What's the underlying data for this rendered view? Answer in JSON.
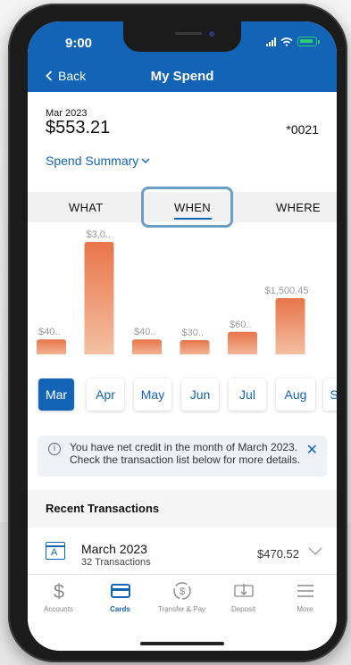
{
  "status": {
    "time": "9:00"
  },
  "header": {
    "back_label": "Back",
    "title": "My Spend"
  },
  "summary": {
    "period": "Mar 2023",
    "amount": "$553.21",
    "account": "*0021",
    "selector_label": "Spend Summary"
  },
  "tabs": [
    {
      "label": "WHAT",
      "selected": false
    },
    {
      "label": "WHEN",
      "selected": true
    },
    {
      "label": "WHERE",
      "selected": false
    }
  ],
  "chart_data": {
    "type": "bar",
    "categories": [
      "Mar",
      "Apr",
      "May",
      "Jun",
      "Jul",
      "Aug"
    ],
    "values": [
      400,
      3000,
      400,
      300,
      600,
      1500.45
    ],
    "data_labels": [
      "$40..",
      "$3,0..",
      "$40..",
      "$30..",
      "$60..",
      "$1,500.45"
    ],
    "bar_color_top": "#e8754a",
    "bar_color_bottom": "#f4c3a6"
  },
  "months": [
    {
      "label": "Mar",
      "active": true
    },
    {
      "label": "Apr",
      "active": false
    },
    {
      "label": "May",
      "active": false
    },
    {
      "label": "Jun",
      "active": false
    },
    {
      "label": "Jul",
      "active": false
    },
    {
      "label": "Aug",
      "active": false
    },
    {
      "label": "Sep",
      "active": false
    }
  ],
  "notice": {
    "text": "You have net credit in the month of March 2023. Check the transaction list below for more details."
  },
  "recent": {
    "title": "Recent Transactions",
    "item": {
      "icon_letter": "A",
      "title": "March 2023",
      "subtitle": "32 Transactions",
      "amount": "$470.52"
    }
  },
  "tabbar": [
    {
      "label": "Accounts",
      "icon": "dollar-icon",
      "active": false
    },
    {
      "label": "Cards",
      "icon": "card-icon",
      "active": true
    },
    {
      "label": "Transfer & Pay",
      "icon": "transfer-icon",
      "active": false
    },
    {
      "label": "Deposit",
      "icon": "deposit-icon",
      "active": false
    },
    {
      "label": "More",
      "icon": "menu-icon",
      "active": false
    }
  ],
  "colors": {
    "brand": "#1363b7",
    "bar": "#e8754a",
    "highlight": "#6a9ec8"
  }
}
